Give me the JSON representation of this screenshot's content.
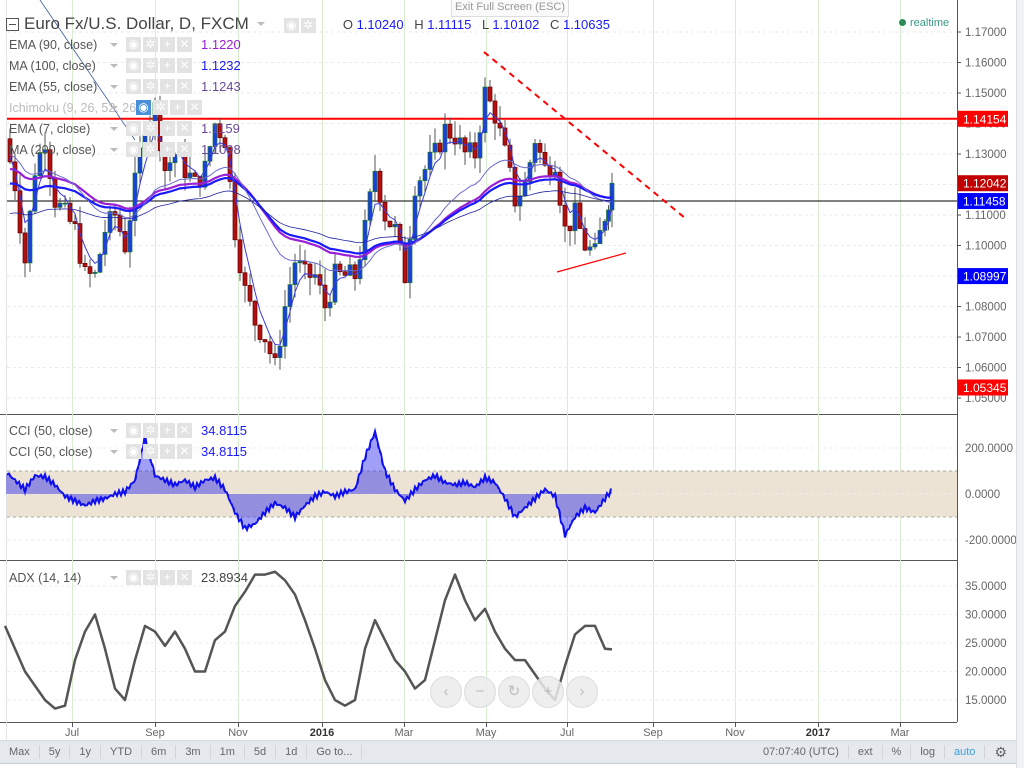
{
  "header": {
    "symbol_title": "Euro Fx/U.S. Dollar, D, FXCM",
    "ohlc": {
      "o_label": "O",
      "o": "1.10240",
      "h_label": "H",
      "h": "1.11115",
      "l_label": "L",
      "l": "1.10102",
      "c_label": "C",
      "c": "1.10635"
    },
    "exit_fullscreen": "Exit Full Screen (ESC)",
    "realtime": "realtime"
  },
  "indicators": [
    {
      "name": "EMA (90, close)",
      "value": "1.1220",
      "color": "#9b1fd6"
    },
    {
      "name": "MA (100, close)",
      "value": "1.1232",
      "color": "#1a1aff"
    },
    {
      "name": "EMA (55, close)",
      "value": "1.1243",
      "color": "#6a4a9a"
    },
    {
      "name": "Ichimoku (9, 26, 52, 26)",
      "value": "",
      "color": "#bbbbbb"
    },
    {
      "name": "EMA (7, close)",
      "value": "1.1159",
      "color": "#6a4a9a"
    },
    {
      "name": "MA (200, close)",
      "value": "1.1098",
      "color": "#6a4a9a"
    }
  ],
  "cci_legends": [
    {
      "name": "CCI (50, close)",
      "value": "34.8115"
    },
    {
      "name": "CCI (50, close)",
      "value": "34.8115"
    }
  ],
  "adx_legend": {
    "name": "ADX (14, 14)",
    "value": "23.8934"
  },
  "price_labels": [
    {
      "value": "1.14154",
      "bg": "#ff0000"
    },
    {
      "value": "1.12042",
      "bg": "#c00000"
    },
    {
      "value": "1.11458",
      "bg": "#0000ff"
    },
    {
      "value": "1.08997",
      "bg": "#0000ff"
    },
    {
      "value": "1.05345",
      "bg": "#ff0000"
    }
  ],
  "toolbar": {
    "ranges": [
      "Max",
      "5y",
      "1y",
      "YTD",
      "6m",
      "3m",
      "1m",
      "5d",
      "1d",
      "Go to..."
    ],
    "time": "07:07:40 (UTC)",
    "right": [
      "ext",
      "%",
      "log",
      "auto"
    ]
  },
  "nav_buttons": [
    "‹",
    "−",
    "↻",
    "+",
    "›"
  ],
  "colors": {
    "up": "#1a3ee0",
    "down": "#b01010",
    "cci": "#1010ee",
    "adx": "#555555",
    "band": "#ece3d5",
    "resistance": "#ff0000"
  },
  "chart_data": {
    "type": "candlestick",
    "title": "Euro Fx/U.S. Dollar, D, FXCM",
    "x_ticks": [
      {
        "label": "Jul",
        "bold": false
      },
      {
        "label": "Sep",
        "bold": false
      },
      {
        "label": "Nov",
        "bold": false
      },
      {
        "label": "2016",
        "bold": true
      },
      {
        "label": "Mar",
        "bold": false
      },
      {
        "label": "May",
        "bold": false
      },
      {
        "label": "Jul",
        "bold": false
      },
      {
        "label": "Sep",
        "bold": false
      },
      {
        "label": "Nov",
        "bold": false
      },
      {
        "label": "2017",
        "bold": true
      },
      {
        "label": "Mar",
        "bold": false
      }
    ],
    "price_axis": {
      "ylim": [
        1.05,
        1.17
      ],
      "ticks": [
        "1.17000",
        "1.16000",
        "1.15000",
        "1.14000",
        "1.13000",
        "1.12000",
        "1.11000",
        "1.10000",
        "1.09000",
        "1.08000",
        "1.07000",
        "1.06000",
        "1.05000"
      ]
    },
    "close_approx_10d": [
      1.135,
      1.12,
      1.095,
      1.125,
      1.135,
      1.115,
      1.11,
      1.105,
      1.09,
      1.09,
      1.105,
      1.11,
      1.1,
      1.12,
      1.14,
      1.145,
      1.125,
      1.13,
      1.125,
      1.12,
      1.125,
      1.14,
      1.135,
      1.105,
      1.085,
      1.075,
      1.07,
      1.06,
      1.08,
      1.095,
      1.09,
      1.09,
      1.08,
      1.09,
      1.09,
      1.09,
      1.105,
      1.125,
      1.11,
      1.105,
      1.09,
      1.12,
      1.125,
      1.13,
      1.138,
      1.136,
      1.13,
      1.13,
      1.15,
      1.143,
      1.13,
      1.115,
      1.12,
      1.135,
      1.125,
      1.128,
      1.105,
      1.11,
      1.1,
      1.097,
      1.11,
      1.1204
    ],
    "horizontal_lines": [
      {
        "price": 1.14154,
        "color": "#ff0000"
      },
      {
        "price": 1.11458,
        "color": "#000000"
      }
    ],
    "trendlines": [
      {
        "from": [
          "2016-05-03",
          1.1616
        ],
        "to": [
          "2016-09-15",
          1.109
        ],
        "style": "dashed",
        "color": "#ff0000"
      },
      {
        "from": [
          "2016-06-24",
          1.0913
        ],
        "to": [
          "2016-08-08",
          1.0975
        ],
        "style": "solid",
        "color": "#ff0000"
      }
    ],
    "cci": {
      "ylim": [
        -270,
        290
      ],
      "ticks": [
        "200.0000",
        "0.0000",
        "-200.0000"
      ],
      "band": [
        -100,
        100
      ],
      "values": [
        100,
        60,
        20,
        80,
        75,
        40,
        -10,
        -30,
        -50,
        -30,
        -20,
        0,
        10,
        60,
        250,
        80,
        60,
        40,
        60,
        30,
        60,
        70,
        20,
        -80,
        -150,
        -130,
        -80,
        -40,
        -60,
        -100,
        -50,
        -10,
        10,
        -10,
        10,
        20,
        160,
        270,
        100,
        20,
        -30,
        20,
        60,
        80,
        50,
        40,
        50,
        30,
        70,
        50,
        -20,
        -100,
        -60,
        -20,
        20,
        -10,
        -180,
        -100,
        -60,
        -80,
        -20,
        35
      ]
    },
    "adx": {
      "ylim": [
        11,
        39
      ],
      "ticks": [
        "35.0000",
        "30.0000",
        "25.0000",
        "20.0000",
        "15.0000"
      ],
      "values": [
        28,
        24,
        20,
        17.5,
        15,
        13.5,
        14,
        22,
        27,
        30,
        24,
        17,
        15,
        22,
        28,
        27,
        24.5,
        27,
        24,
        20,
        20,
        25.5,
        27,
        31.5,
        34,
        37,
        37,
        37.5,
        36,
        33.5,
        29,
        24,
        18.5,
        15,
        14,
        15,
        24,
        29,
        25.5,
        22,
        20,
        17,
        18.5,
        25.5,
        32.5,
        37,
        32.5,
        29,
        31,
        27,
        24,
        22,
        22,
        19.5,
        17,
        15,
        21,
        26.5,
        28,
        28,
        24,
        23.89
      ]
    }
  }
}
